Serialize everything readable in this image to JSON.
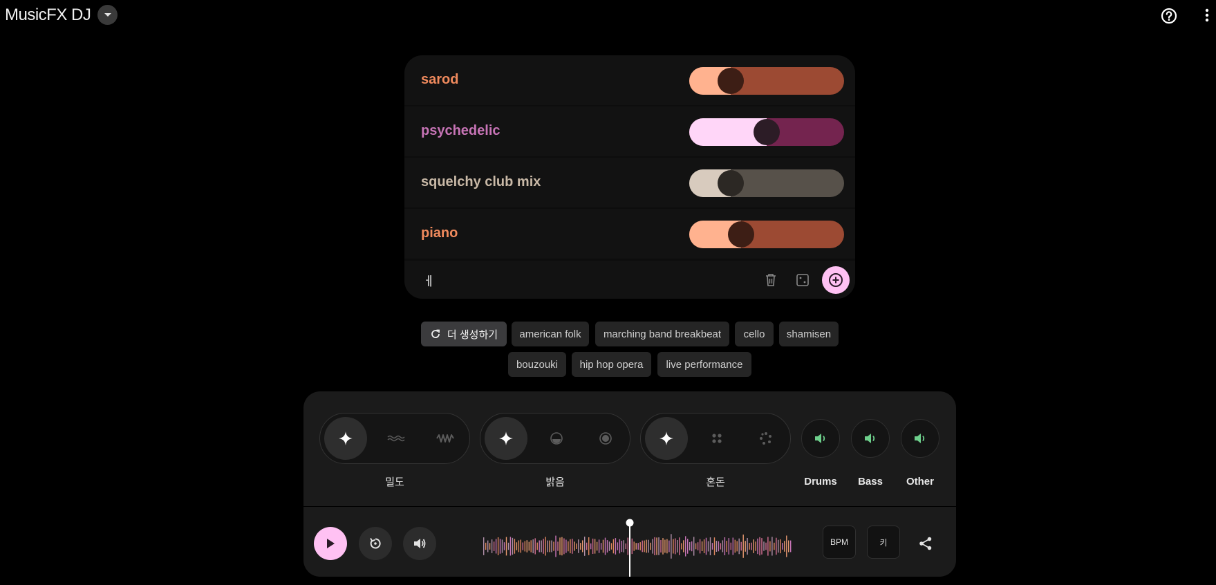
{
  "app": {
    "title": "MusicFX DJ"
  },
  "prompts": [
    {
      "label": "sarod",
      "color": "#f08a5d",
      "light": "#ffb28f",
      "dark": "#9c4a33",
      "knob": "#3d1e15",
      "level": 0.22
    },
    {
      "label": "psychedelic",
      "color": "#c774b6",
      "light": "#ffd6f8",
      "dark": "#74244f",
      "knob": "#2c1c26",
      "level": 0.5
    },
    {
      "label": "squelchy club mix",
      "color": "#c9b9a7",
      "light": "#d8cbbe",
      "dark": "#57514a",
      "knob": "#2c2824",
      "level": 0.22
    },
    {
      "label": "piano",
      "color": "#f08a5d",
      "light": "#ffb28f",
      "dark": "#9c4a33",
      "knob": "#3d1e15",
      "level": 0.3
    }
  ],
  "prompt_input": {
    "value": "ㅔ"
  },
  "chips": {
    "generate_label": "더 생성하기",
    "items": [
      "american folk",
      "marching band breakbeat",
      "cello",
      "shamisen",
      "bouzouki",
      "hip hop opera",
      "live performance"
    ]
  },
  "controls": {
    "density": {
      "label": "밀도"
    },
    "brightness": {
      "label": "밝음"
    },
    "chaos": {
      "label": "혼돈"
    },
    "stems": [
      "Drums",
      "Bass",
      "Other"
    ]
  },
  "transport": {
    "bpm_label": "BPM",
    "key_label": "키"
  },
  "colors": {
    "accent_pink": "#ffc1f3",
    "stem_green": "#6ed08c"
  }
}
